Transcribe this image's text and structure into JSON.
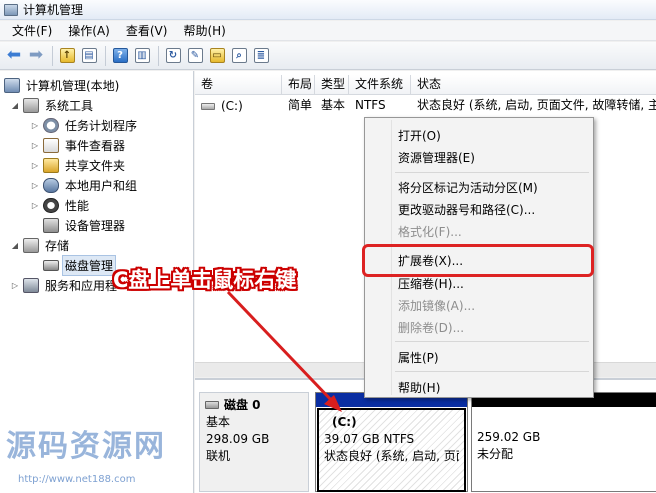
{
  "window": {
    "title": "计算机管理"
  },
  "menu": [
    "文件(F)",
    "操作(A)",
    "查看(V)",
    "帮助(H)"
  ],
  "tree": {
    "root": "计算机管理(本地)",
    "system_tools": "系统工具",
    "task_scheduler": "任务计划程序",
    "event_viewer": "事件查看器",
    "shared_folders": "共享文件夹",
    "local_users": "本地用户和组",
    "performance": "性能",
    "device_manager": "设备管理器",
    "storage": "存储",
    "disk_management": "磁盘管理",
    "services": "服务和应用程"
  },
  "columns": [
    "卷",
    "布局",
    "类型",
    "文件系统",
    "状态"
  ],
  "volume_row": {
    "name": "(C:)",
    "layout": "简单",
    "type": "基本",
    "fs": "NTFS",
    "status": "状态良好 (系统, 启动, 页面文件, 故障转储, 主"
  },
  "disk": {
    "name": "磁盘 0",
    "kind": "基本",
    "size": "298.09 GB",
    "state": "联机"
  },
  "partition_c": {
    "name": "(C:)",
    "size": "39.07 GB NTFS",
    "status": "状态良好 (系统, 启动, 页面"
  },
  "partition_free": {
    "size": "259.02 GB",
    "status": "未分配"
  },
  "context_menu": {
    "open": "打开(O)",
    "explorer": "资源管理器(E)",
    "mark_active": "将分区标记为活动分区(M)",
    "change_letter": "更改驱动器号和路径(C)...",
    "format": "格式化(F)...",
    "extend": "扩展卷(X)...",
    "shrink": "压缩卷(H)...",
    "add_mirror": "添加镜像(A)...",
    "delete": "删除卷(D)...",
    "properties": "属性(P)",
    "help": "帮助(H)"
  },
  "annotation": "C盘上单击鼠标右键",
  "watermark": {
    "text": "源码资源网",
    "url": "http://www.net188.com"
  }
}
